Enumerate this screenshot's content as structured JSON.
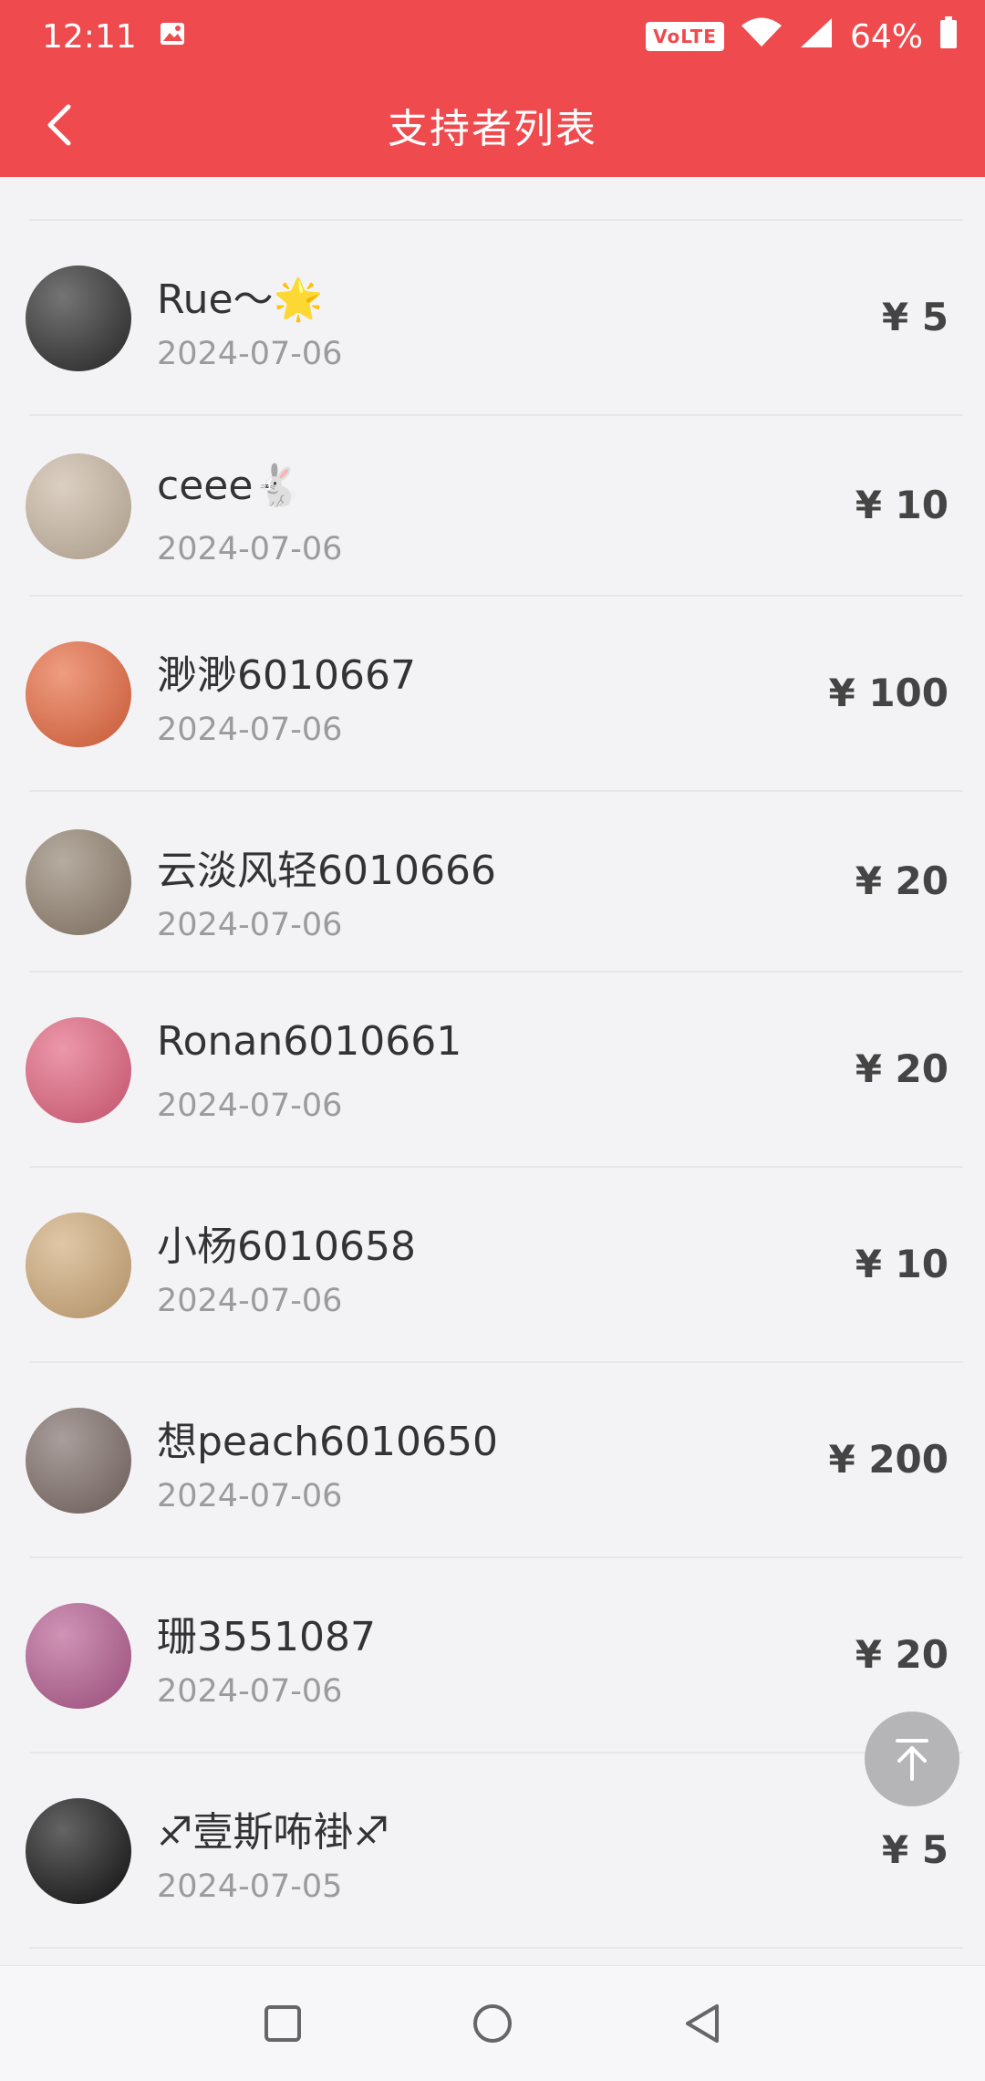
{
  "status": {
    "time": "12:11",
    "volte": "VoLTE",
    "battery": "64%"
  },
  "header": {
    "title": "支持者列表"
  },
  "supporters": [
    {
      "name": "Rue～🌟",
      "date": "2024-07-06",
      "amount": "¥ 5",
      "avatar_color": "#2b2a2a"
    },
    {
      "name": "ceee🐇",
      "date": "2024-07-06",
      "amount": "¥ 10",
      "avatar_color": "#c8b6a1"
    },
    {
      "name": "渺渺6010667",
      "date": "2024-07-06",
      "amount": "¥ 100",
      "avatar_color": "#e7673d"
    },
    {
      "name": "云淡风轻6010666",
      "date": "2024-07-06",
      "amount": "¥ 20",
      "avatar_color": "#8f7f6d"
    },
    {
      "name": "Ronan6010661",
      "date": "2024-07-06",
      "amount": "¥ 20",
      "avatar_color": "#e2607d"
    },
    {
      "name": "小杨6010658",
      "date": "2024-07-06",
      "amount": "¥ 10",
      "avatar_color": "#cfa977"
    },
    {
      "name": "想peach6010650",
      "date": "2024-07-06",
      "amount": "¥ 200",
      "avatar_color": "#7b6a66"
    },
    {
      "name": "珊3551087",
      "date": "2024-07-06",
      "amount": "¥ 20",
      "avatar_color": "#b45a8e"
    },
    {
      "name": "♐壹斯咘褂♐",
      "date": "2024-07-05",
      "amount": "¥ 5",
      "avatar_color": "#111111"
    }
  ]
}
